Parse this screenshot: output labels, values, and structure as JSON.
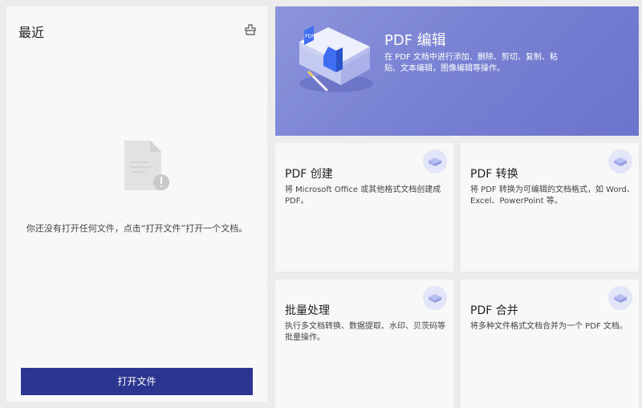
{
  "recent": {
    "title": "最近",
    "empty_message": "你还没有打开任何文件，点击“打开文件”打开一个文档。",
    "open_button": "打开文件"
  },
  "hero": {
    "title": "PDF 编辑",
    "description": "在 PDF 文档中进行添加、删除、剪切、复制、粘贴、文本编辑，图像编辑等操作。",
    "icon_text": "PDF",
    "illustration_icon": "pdf-stack-illustration"
  },
  "cards": [
    {
      "title": "PDF 创建",
      "description": "将 Microsoft Office 或其他格式文档创建成 PDF。",
      "icon": "create-icon"
    },
    {
      "title": "PDF 转换",
      "description": "将 PDF 转换为可编辑的文档格式，如 Word、Excel、PowerPoint 等。",
      "icon": "convert-icon"
    },
    {
      "title": "批量处理",
      "description": "执行多文档转换、数据提取、水印、贝茨码等批量操作。",
      "icon": "batch-icon"
    },
    {
      "title": "PDF 合并",
      "description": "将多种文件格式文档合并为一个 PDF 文档。",
      "icon": "combine-icon"
    }
  ],
  "colors": {
    "accent": "#2c3590",
    "hero_bg": "#7780d2",
    "panel_bg": "#f8f8f9",
    "page_bg": "#ececec"
  }
}
